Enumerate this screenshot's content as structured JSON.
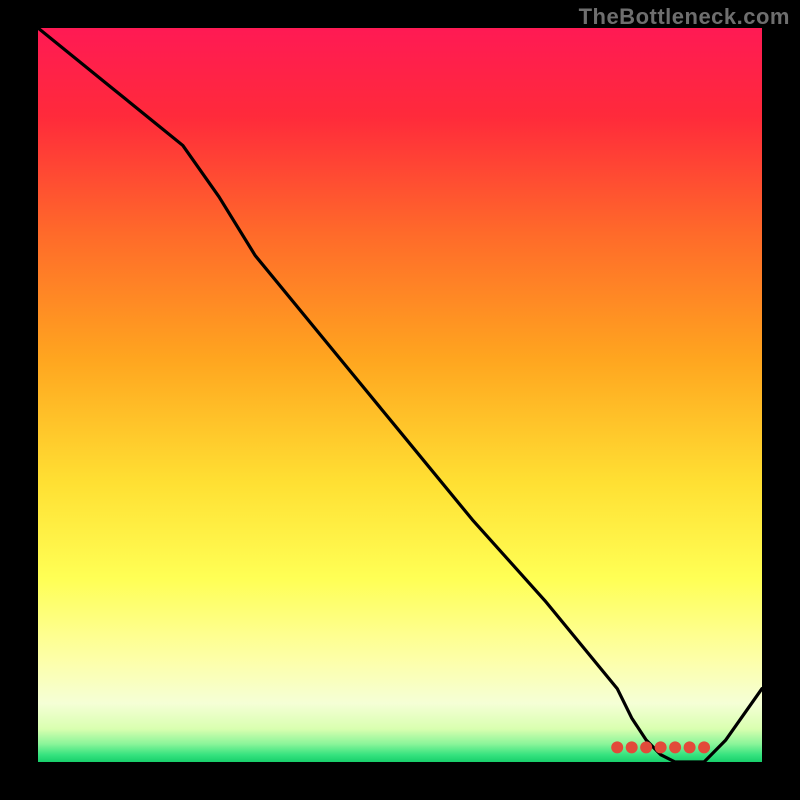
{
  "watermark": "TheBottleneck.com",
  "chart_data": {
    "type": "line",
    "x": [
      0,
      10,
      20,
      25,
      30,
      40,
      50,
      60,
      70,
      80,
      82,
      84,
      86,
      88,
      90,
      92,
      95,
      100
    ],
    "values": [
      100,
      92,
      84,
      77,
      69,
      57,
      45,
      33,
      22,
      10,
      6,
      3,
      1,
      0,
      0,
      0,
      3,
      10
    ],
    "marker_points_x": [
      80,
      82,
      84,
      86,
      88,
      90,
      92
    ],
    "marker_points_y": [
      2,
      2,
      2,
      2,
      2,
      2,
      2
    ],
    "title": "",
    "xlabel": "",
    "ylabel": "",
    "xlim": [
      0,
      100
    ],
    "ylim": [
      0,
      100
    ],
    "background_gradient_stops": [
      {
        "offset": 0.0,
        "color": "#ff1a54"
      },
      {
        "offset": 0.12,
        "color": "#ff2a3b"
      },
      {
        "offset": 0.28,
        "color": "#ff6a2a"
      },
      {
        "offset": 0.45,
        "color": "#ffa51f"
      },
      {
        "offset": 0.62,
        "color": "#ffe033"
      },
      {
        "offset": 0.75,
        "color": "#ffff55"
      },
      {
        "offset": 0.86,
        "color": "#fdffa8"
      },
      {
        "offset": 0.92,
        "color": "#f5ffd6"
      },
      {
        "offset": 0.955,
        "color": "#d9ffb0"
      },
      {
        "offset": 0.975,
        "color": "#8cf59a"
      },
      {
        "offset": 0.99,
        "color": "#37e37f"
      },
      {
        "offset": 1.0,
        "color": "#18cf6b"
      }
    ],
    "line_color": "#000000",
    "marker_color": "#e24a3a"
  }
}
